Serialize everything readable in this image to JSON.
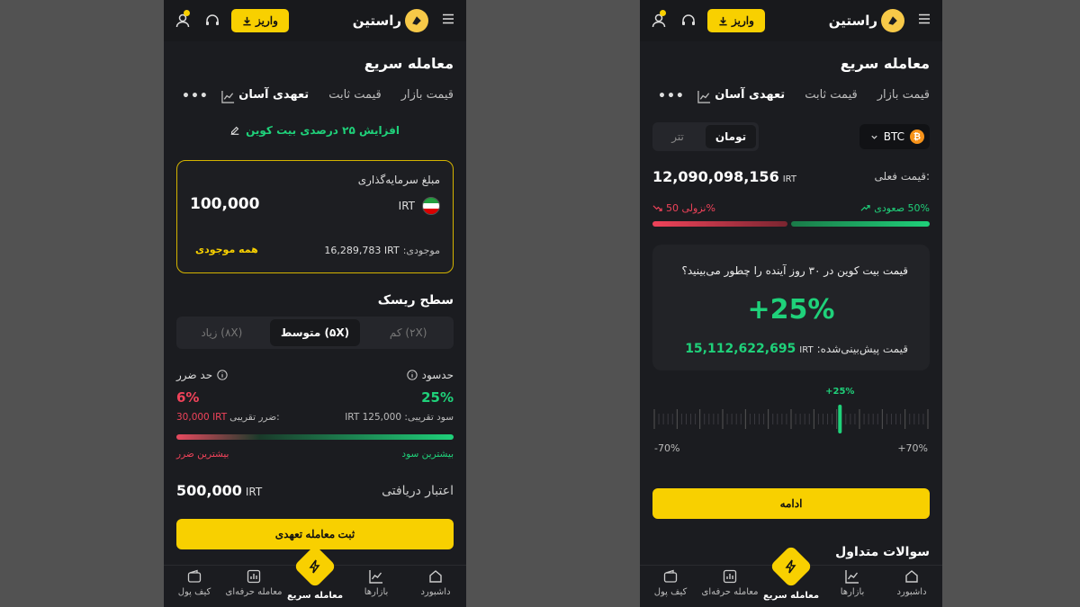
{
  "colors": {
    "accent": "#f8d000",
    "bg": "#1b1c20",
    "green": "#1fd17a",
    "red": "#f0435a",
    "bitcoin": "#f7931a"
  },
  "header": {
    "brand": "راستین",
    "deposit_label": "واریز"
  },
  "title": "معامله سریع",
  "tabs": [
    "قیمت بازار",
    "قیمت ثابت",
    "تعهدی آسان"
  ],
  "screenA": {
    "promo": "افزایش ۲۵ درصدی بیت کوین",
    "investment": {
      "label": "مبلغ سرمایه‌گذاری",
      "amount": "100,000",
      "currency": "IRT",
      "balance_label": "موجودی:",
      "balance_value": "16,289,783 IRT",
      "all_balance": "همه موجودی"
    },
    "risk": {
      "title": "سطح ریسک",
      "levels": [
        "کم (۲X)",
        "متوسط (۵X)",
        "زیاد (۸X)"
      ],
      "target_label": "حدسود",
      "target_value": "25%",
      "target_profit": "سود تقریبی: 125,000 IRT",
      "stop_label": "حد ضرر",
      "stop_value": "6%",
      "stop_loss_label": "ضرر تقریبی:",
      "stop_loss_value": "30,000 IRT",
      "max_profit": "بیشترین سود",
      "max_loss": "بیشترین ضرر"
    },
    "credit_label": "اعتبار دریافتی",
    "credit_value": "500,000",
    "credit_currency": "IRT",
    "submit_label": "ثبت معامله تعهدی"
  },
  "screenB": {
    "coin": "BTC",
    "coin_symbol": "₿",
    "currencies": [
      "تومان",
      "تتر"
    ],
    "current_price_label": "قیمت فعلی:",
    "current_price": "12,090,098,156",
    "current_price_unit": "IRT",
    "bull_label": "50% صعودی",
    "bear_label": "نزولی 50%",
    "question": "قیمت بیت کوین در ۳۰ روز آینده را چطور می‌بینید؟",
    "percent": "+25%",
    "predicted_label": "قیمت پیش‌بینی‌شده:",
    "predicted_unit": "IRT",
    "predicted_value": "15,112,622,695",
    "slider_value_label": "+25%",
    "slider_value": 25,
    "slider_min": "-70%",
    "slider_max": "+70%",
    "continue_label": "ادامه",
    "faq_title": "سوالات متداول"
  },
  "nav": [
    "داشبورد",
    "بازارها",
    "معامله سریع",
    "معامله حرفه‌ای",
    "کیف پول"
  ]
}
